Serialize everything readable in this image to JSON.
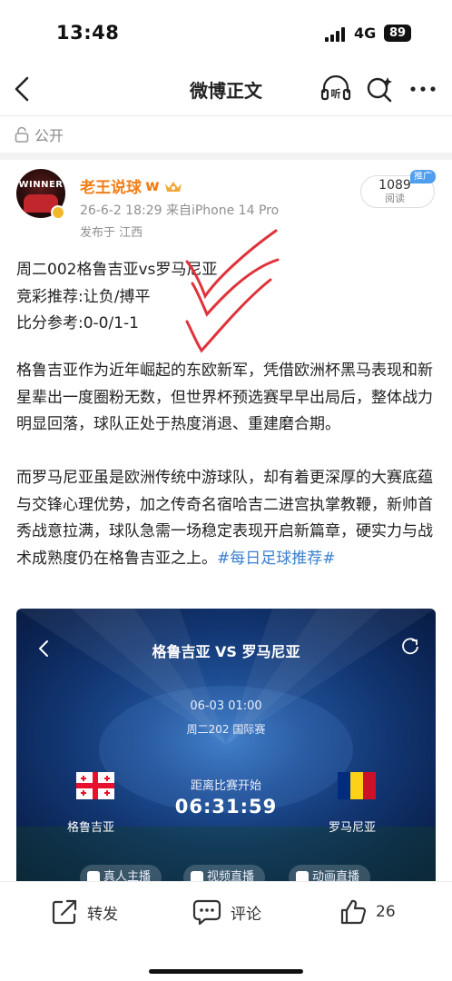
{
  "status_bar": {
    "time": "13:48",
    "network": "4G",
    "battery": "89"
  },
  "nav": {
    "title": "微博正文",
    "listen_label": "听"
  },
  "privacy": {
    "label": "公开"
  },
  "author": {
    "name": "老王说球",
    "name_suffix": "w",
    "avatar_text": "WINNER",
    "meta": "26-6-2 18:29  来自iPhone 14 Pro",
    "location": "发布于 江西",
    "read_count": "1089",
    "read_label": "阅读",
    "promo_badge": "推广"
  },
  "post": {
    "line1": "周二002格鲁吉亚vs罗马尼亚",
    "line2": "竞彩推荐:让负/搏平",
    "line3": "比分参考:0-0/1-1",
    "para1": "格鲁吉亚作为近年崛起的东欧新军，凭借欧洲杯黑马表现和新星辈出一度圈粉无数，但世界杯预选赛早早出局后，整体战力明显回落，球队正处于热度消退、重建磨合期。",
    "para2": "而罗马尼亚虽是欧洲传统中游球队，却有着更深厚的大赛底蕴与交锋心理优势，加之传奇名宿哈吉二进宫执掌教鞭，新帅首秀战意拉满，球队急需一场稳定表现开启新篇章，硬实力与战术成熟度仍在格鲁吉亚之上。",
    "hashtag": "#每日足球推荐#"
  },
  "match_card": {
    "title": "格鲁吉亚 VS 罗马尼亚",
    "datetime": "06-03 01:00",
    "league": "周二202 国际赛",
    "countdown_label": "距离比赛开始",
    "countdown": "06:31:59",
    "home_team": "格鲁吉亚",
    "away_team": "罗马尼亚",
    "pills": [
      "真人主播",
      "视频直播",
      "动画直播"
    ]
  },
  "actions": {
    "repost": "转发",
    "comment": "评论",
    "like_count": "26"
  },
  "colors": {
    "accent_orange": "#f07e18",
    "link_blue": "#3a7fcf",
    "check_red": "#e0323a",
    "promo_blue": "#4f9ef0"
  }
}
